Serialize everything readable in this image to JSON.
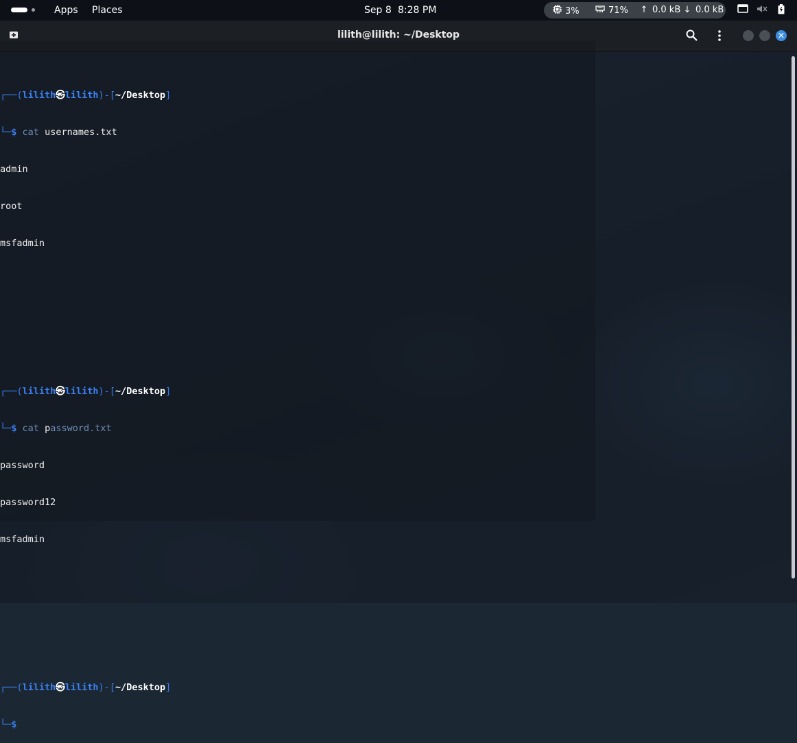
{
  "top_panel": {
    "apps": "Apps",
    "places": "Places",
    "date": "Sep 8",
    "time": "8:28 PM",
    "cpu": "3%",
    "memory": "71%",
    "upload": "0.0 kB",
    "download": "0.0 kB",
    "icons": [
      "activities-icon",
      "cpu-icon",
      "memory-icon",
      "upload-arrow-icon",
      "download-arrow-icon",
      "screen-icon",
      "mute-icon",
      "battery-icon"
    ]
  },
  "window": {
    "title": "lilith@lilith: ~/Desktop",
    "icons": [
      "new-tab-icon",
      "search-icon",
      "kebab-menu-icon",
      "minimize-icon",
      "maximize-icon",
      "close-icon"
    ],
    "accent": "#3d8fe6"
  },
  "terminal": {
    "prompt": {
      "user": "lilith",
      "at": "㉿",
      "host": "lilith",
      "cwd": "~/Desktop",
      "frame_top_left": "┌──(",
      "frame_mid": ")-[",
      "frame_close": "]",
      "frame_bottom": "└─",
      "dollar": "$"
    },
    "block1": {
      "cmd": "cat",
      "arg": "usernames.txt",
      "output": [
        "admin",
        "root",
        "msfadmin"
      ]
    },
    "block2": {
      "cmd": "cat",
      "arg_first": "p",
      "arg_rest": "assword.txt",
      "output": [
        "password",
        "password12",
        "msfadmin"
      ]
    }
  },
  "colors": {
    "prompt_blue": "#3b82f6",
    "text": "#f0f0f0",
    "titlebar": "#1c1f24",
    "panel": "#0d1117"
  }
}
